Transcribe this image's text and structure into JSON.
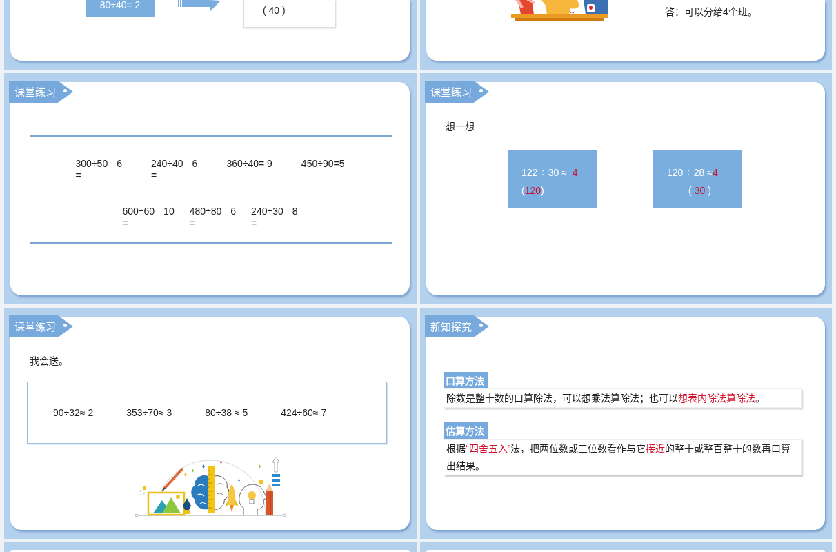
{
  "slides": [
    {
      "kind": "conversion",
      "equation": "80÷40= 2",
      "answer": "( 40 )"
    },
    {
      "kind": "word_problem",
      "answer": "答：可以分给4个班。"
    },
    {
      "kind": "mental_division",
      "title": "课堂练习",
      "rows": [
        {
          "items": [
            {
              "kind": "wrapped",
              "expression": "300÷50",
              "sign": "=",
              "answer": "6"
            },
            {
              "kind": "wrapped",
              "expression": "240÷40",
              "sign": "=",
              "answer": "6"
            },
            {
              "kind": "inline",
              "text": "360÷40= 9"
            },
            {
              "kind": "inline",
              "text": "450÷90=5"
            }
          ]
        },
        {
          "items": [
            {
              "kind": "wrapped",
              "expression": "600÷60",
              "sign": "=",
              "answer": "10"
            },
            {
              "kind": "wrapped",
              "expression": "480÷80",
              "sign": "=",
              "answer": "6"
            },
            {
              "kind": "wrapped",
              "expression": "240÷30",
              "sign": "=",
              "answer": "8"
            }
          ]
        }
      ]
    },
    {
      "kind": "think",
      "title": "课堂练习",
      "prompt": "想一想",
      "boxes": [
        {
          "lines": [
            {
              "segments": [
                {
                  "text": "122 ÷ 30 ≈  ",
                  "highlight": false
                },
                {
                  "text": "4",
                  "highlight": true
                }
              ]
            },
            {
              "segments": [
                {
                  "text": "(",
                  "highlight": false
                },
                {
                  "text": "120",
                  "highlight": true
                },
                {
                  "text": ")",
                  "highlight": false
                }
              ]
            }
          ]
        },
        {
          "lines": [
            {
              "segments": [
                {
                  "text": "120 ÷ 28 ≈",
                  "highlight": false
                },
                {
                  "text": "4",
                  "highlight": true
                }
              ]
            },
            {
              "segments": [
                {
                  "text": "        ( ",
                  "highlight": false
                },
                {
                  "text": "30",
                  "highlight": true
                },
                {
                  "text": " )",
                  "highlight": false
                }
              ]
            }
          ]
        }
      ]
    },
    {
      "kind": "estimate",
      "title": "课堂练习",
      "prompt": "我会送。",
      "items": [
        "90÷32≈ 2",
        "353÷70≈ 3",
        "80÷38 ≈ 5",
        "424÷60≈ 7"
      ]
    },
    {
      "kind": "methods",
      "title": "新知探究",
      "sections": [
        {
          "label": "口算方法",
          "segments": [
            {
              "text": "除数是整十数的口算除法，可以想乘法算除法；也可以",
              "highlight": false
            },
            {
              "text": "想表内除法算除法",
              "highlight": true
            },
            {
              "text": "。",
              "highlight": false
            }
          ]
        },
        {
          "label": "估算方法",
          "segments": [
            {
              "text": "根据",
              "highlight": false
            },
            {
              "text": "“四舍五入”",
              "highlight": true
            },
            {
              "text": "法，把两位数或三位数看作与它",
              "highlight": false
            },
            {
              "text": "接近",
              "highlight": true
            },
            {
              "text": "的整十或整百整十的数再口算出结果。",
              "highlight": false
            }
          ]
        }
      ]
    },
    {
      "kind": "cut_off"
    },
    {
      "kind": "cut_off"
    }
  ]
}
